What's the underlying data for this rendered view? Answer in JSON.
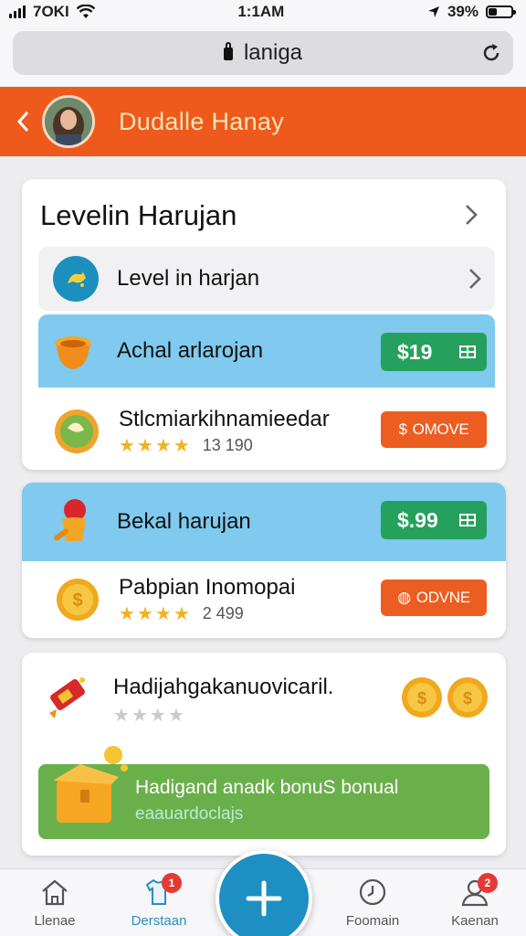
{
  "status_bar": {
    "carrier": "7OKI",
    "time": "1:1AM",
    "battery": "39%"
  },
  "browser": {
    "url": "laniga"
  },
  "header": {
    "title": "Dudalle Hanay"
  },
  "card1": {
    "title": "Levelin Harujan",
    "level_row": {
      "label": "Level in harjan"
    },
    "offer1": {
      "name": "Achal arlarojan",
      "price": "$19"
    },
    "item1": {
      "name": "Stlcmiarkihnamieedar",
      "rating": 4,
      "rating_text": "13 190",
      "buy_label": "OMOVE"
    }
  },
  "card2": {
    "offer": {
      "name": "Bekal harujan",
      "price": "$.99"
    },
    "item": {
      "name": "Pabpian Inomopai",
      "rating": 4,
      "rating_text": "2 499",
      "buy_label": "ODVNE"
    }
  },
  "card3": {
    "item": {
      "name": "Hadijahgakanuovicaril.",
      "rating": 0
    },
    "bonus": {
      "title": "Hadigand anadk bonuS bonual",
      "subtitle": "eaauardoclajs"
    }
  },
  "bottom_nav": {
    "items": [
      {
        "label": "Llenae",
        "badge": ""
      },
      {
        "label": "Derstaan",
        "badge": "1"
      },
      {
        "label": "Foomain",
        "badge": ""
      },
      {
        "label": "Kaenan",
        "badge": "2"
      }
    ]
  },
  "colors": {
    "brand_orange": "#ee5a1c",
    "price_green": "#26a05d",
    "offer_blue": "#7fcaee",
    "bonus_green": "#6ab04a",
    "fab_blue": "#1d8fc2"
  }
}
